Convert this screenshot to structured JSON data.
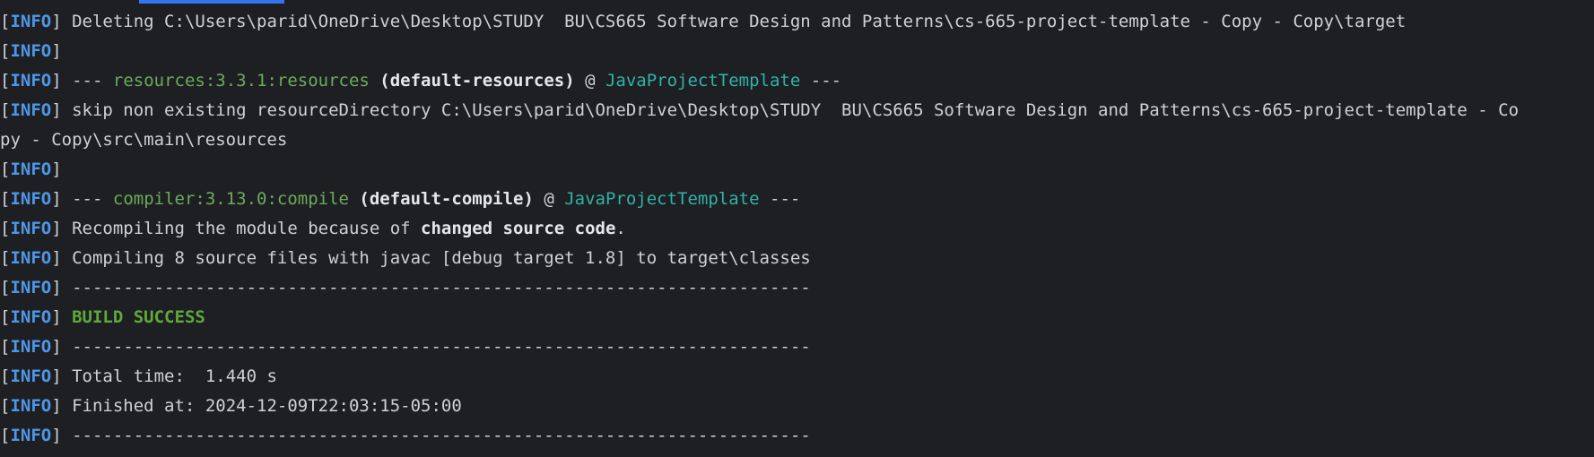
{
  "console": {
    "level": "INFO",
    "lines": [
      {
        "msg": " Deleting C:\\Users\\parid\\OneDrive\\Desktop\\STUDY  BU\\CS665 Software Design and Patterns\\cs-665-project-template - Copy - Copy\\target"
      },
      {
        "msg": ""
      },
      {
        "prefix": " --- ",
        "plugin": "resources:3.3.1:resources",
        "exec": " (default-resources)",
        "at": " @ ",
        "project": "JavaProjectTemplate",
        "suffix": " ---"
      },
      {
        "msg": " skip non existing resourceDirectory C:\\Users\\parid\\OneDrive\\Desktop\\STUDY  BU\\CS665 Software Design and Patterns\\cs-665-project-template - Co"
      },
      {
        "wrap": "py - Copy\\src\\main\\resources"
      },
      {
        "msg": ""
      },
      {
        "prefix": " --- ",
        "plugin": "compiler:3.13.0:compile",
        "exec": " (default-compile)",
        "at": " @ ",
        "project": "JavaProjectTemplate",
        "suffix": " ---"
      },
      {
        "pre": " Recompiling the module because of ",
        "bold": "changed source code",
        "post": "."
      },
      {
        "msg": " Compiling 8 source files with javac [debug target 1.8] to target\\classes"
      },
      {
        "msg": " ------------------------------------------------------------------------"
      },
      {
        "success": " BUILD SUCCESS"
      },
      {
        "msg": " ------------------------------------------------------------------------"
      },
      {
        "msg": " Total time:  1.440 s"
      },
      {
        "msg": " Finished at: 2024-12-09T22:03:15-05:00"
      },
      {
        "msg": " ------------------------------------------------------------------------"
      }
    ]
  },
  "colors": {
    "background": "#1e1f22",
    "info": "#4e97e8",
    "plugin": "#6aab5c",
    "project": "#2fb3a8",
    "success": "#5fa83a"
  }
}
